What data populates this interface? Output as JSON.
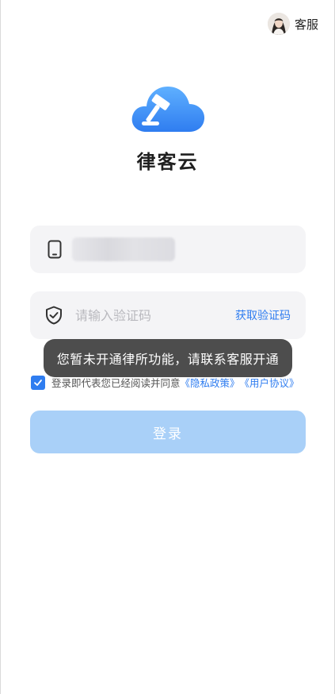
{
  "header": {
    "service_label": "客服"
  },
  "brand": {
    "app_name": "律客云"
  },
  "form": {
    "phone": {
      "icon": "phone-icon"
    },
    "code": {
      "placeholder": "请输入验证码",
      "icon": "shield-check-icon",
      "get_code_label": "获取验证码"
    },
    "toast": "您暂未开通律所功能，请联系客服开通",
    "agreement": {
      "checked": true,
      "text": "登录即代表您已经阅读并同意",
      "privacy_link": "《隐私政策》",
      "user_link": "《用户协议》"
    },
    "login_label": "登录"
  },
  "colors": {
    "accent": "#2f7df0",
    "button_disabled": "#a9d0f8",
    "field_bg": "#f4f4f6",
    "toast_bg": "#424242"
  }
}
